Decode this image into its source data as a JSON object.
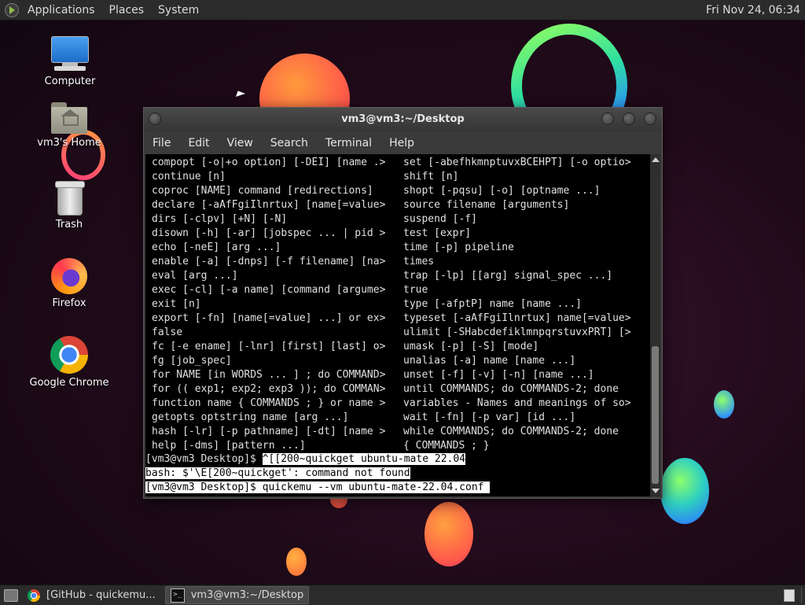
{
  "top_panel": {
    "menus": [
      "Applications",
      "Places",
      "System"
    ],
    "clock": "Fri Nov 24, 06:34"
  },
  "desktop_icons": [
    {
      "label": "Computer",
      "icon": "computer-icon"
    },
    {
      "label": "vm3's Home",
      "icon": "home-folder-icon"
    },
    {
      "label": "Trash",
      "icon": "trash-icon"
    },
    {
      "label": "Firefox",
      "icon": "firefox-icon"
    },
    {
      "label": "Google Chrome",
      "icon": "chrome-icon"
    }
  ],
  "terminal_window": {
    "title": "vm3@vm3:~/Desktop",
    "menu": [
      "File",
      "Edit",
      "View",
      "Search",
      "Terminal",
      "Help"
    ],
    "rows": [
      [
        "compopt [-o|+o option] [-DEI] [name .>",
        "set [-abefhkmnptuvxBCEHPT] [-o optio>"
      ],
      [
        "continue [n]",
        "shift [n]"
      ],
      [
        "coproc [NAME] command [redirections]",
        "shopt [-pqsu] [-o] [optname ...]"
      ],
      [
        "declare [-aAfFgiIlnrtux] [name[=value>",
        "source filename [arguments]"
      ],
      [
        "dirs [-clpv] [+N] [-N]",
        "suspend [-f]"
      ],
      [
        "disown [-h] [-ar] [jobspec ... | pid >",
        "test [expr]"
      ],
      [
        "echo [-neE] [arg ...]",
        "time [-p] pipeline"
      ],
      [
        "enable [-a] [-dnps] [-f filename] [na>",
        "times"
      ],
      [
        "eval [arg ...]",
        "trap [-lp] [[arg] signal_spec ...]"
      ],
      [
        "exec [-cl] [-a name] [command [argume>",
        "true"
      ],
      [
        "exit [n]",
        "type [-afptP] name [name ...]"
      ],
      [
        "export [-fn] [name[=value] ...] or ex>",
        "typeset [-aAfFgiIlnrtux] name[=value>"
      ],
      [
        "false",
        "ulimit [-SHabcdefiklmnpqrstuvxPRT] [>"
      ],
      [
        "fc [-e ename] [-lnr] [first] [last] o>",
        "umask [-p] [-S] [mode]"
      ],
      [
        "fg [job_spec]",
        "unalias [-a] name [name ...]"
      ],
      [
        "for NAME [in WORDS ... ] ; do COMMAND>",
        "unset [-f] [-v] [-n] [name ...]"
      ],
      [
        "for (( exp1; exp2; exp3 )); do COMMAN>",
        "until COMMANDS; do COMMANDS-2; done"
      ],
      [
        "function name { COMMANDS ; } or name >",
        "variables - Names and meanings of so>"
      ],
      [
        "getopts optstring name [arg ...]",
        "wait [-fn] [-p var] [id ...]"
      ],
      [
        "hash [-lr] [-p pathname] [-dt] [name >",
        "while COMMANDS; do COMMANDS-2; done"
      ],
      [
        "help [-dms] [pattern ...]",
        "{ COMMANDS ; }"
      ]
    ],
    "line1_prompt": "[vm3@vm3 Desktop]$ ",
    "line1_cmd": "^[[200~quickget ubuntu-mate 22.04",
    "line2": "bash: $'\\E[200~quickget': command not found",
    "line3": "[vm3@vm3 Desktop]$ quickemu --vm ubuntu-mate-22.04.conf "
  },
  "taskbar": {
    "tasks": [
      {
        "label": "[GitHub - quickemu...",
        "icon": "chrome-icon"
      },
      {
        "label": "vm3@vm3:~/Desktop",
        "icon": "terminal-icon"
      }
    ]
  }
}
